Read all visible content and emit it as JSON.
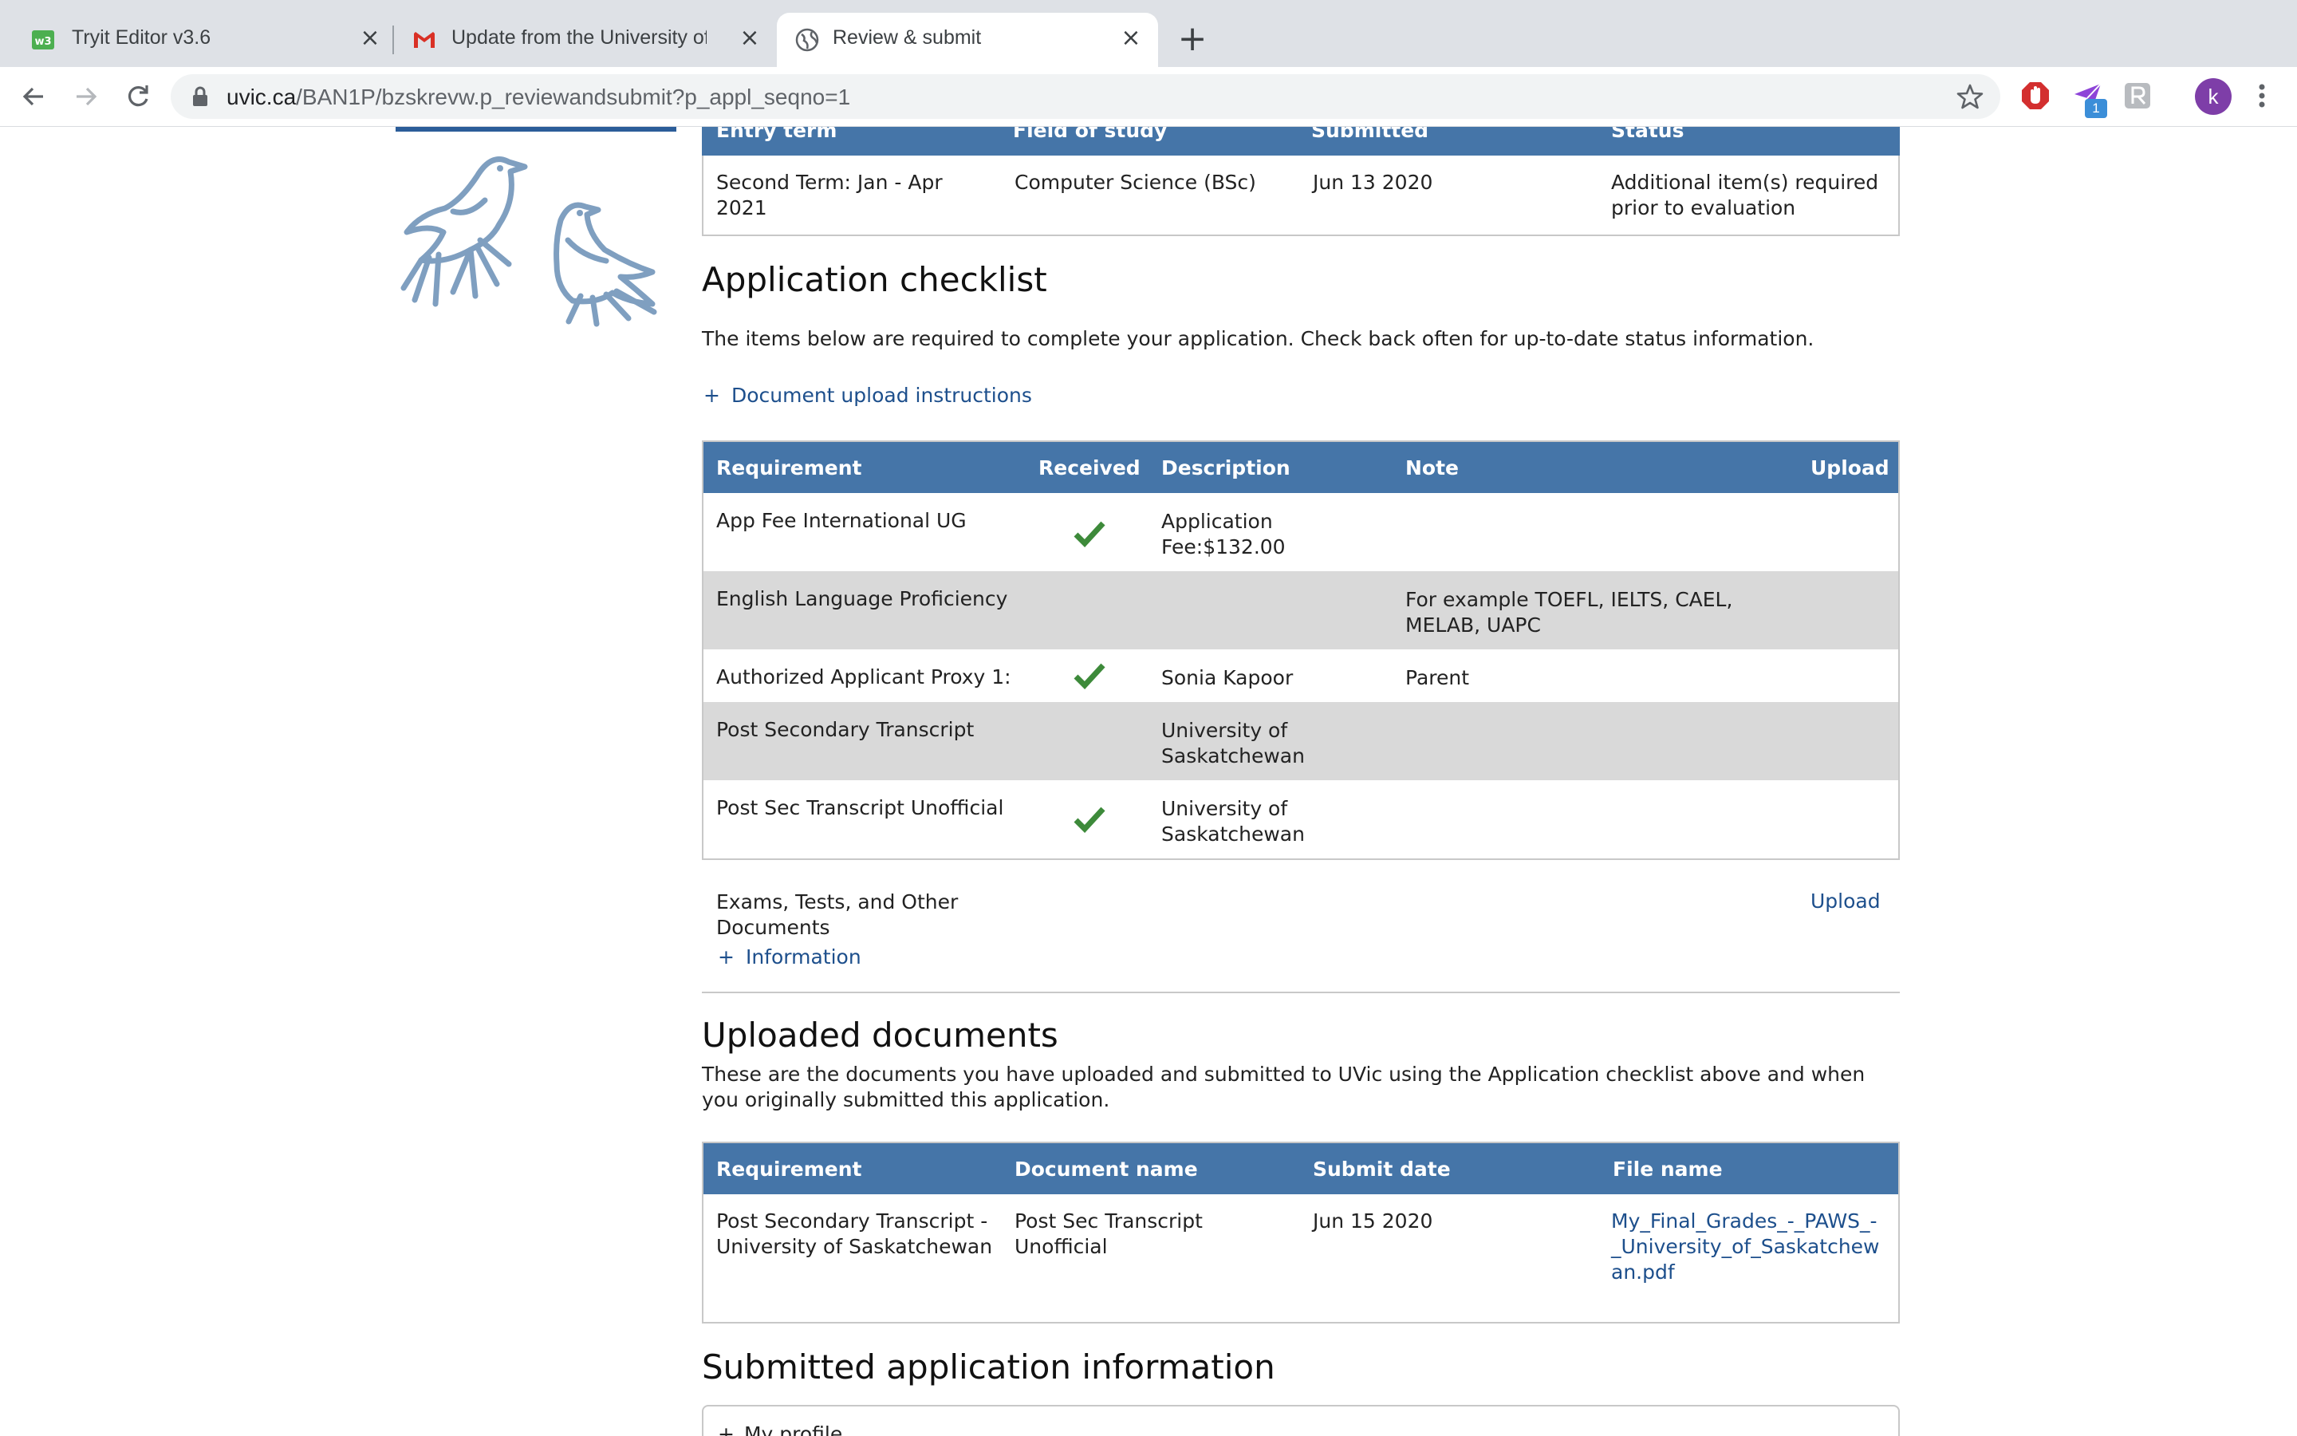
{
  "browser": {
    "tabs": [
      {
        "title": "Tryit Editor v3.6",
        "active": false
      },
      {
        "title": "Update from the University of V",
        "active": false
      },
      {
        "title": "Review & submit",
        "active": true
      }
    ],
    "new_tab_label": "+",
    "close_glyph": "×",
    "url_host": "uvic.ca",
    "url_path": "/BAN1P/bzskrevw.p_reviewandsubmit?p_appl_seqno=1",
    "ext_badge_count": "1",
    "profile_initial": "k"
  },
  "summary_table": {
    "headers": [
      "Entry term",
      "Field of study",
      "Submitted",
      "Status"
    ],
    "row": [
      "Second Term: Jan - Apr 2021",
      "Computer Science (BSc)",
      "Jun 13 2020",
      "Additional item(s) required prior to evaluation"
    ]
  },
  "checklist": {
    "title": "Application checklist",
    "intro": "The items below are required to complete your application. Check back often for up-to-date status information.",
    "upload_instructions_link": "Document upload instructions",
    "expand_glyph": "+",
    "headers": {
      "requirement": "Requirement",
      "received": "Received",
      "description": "Description",
      "note": "Note",
      "upload": "Upload"
    },
    "rows": [
      {
        "requirement": "App Fee International UG",
        "received": true,
        "description": "Application Fee:$132.00",
        "note": ""
      },
      {
        "requirement": "English Language Proficiency",
        "received": false,
        "description": "",
        "note": "For example TOEFL, IELTS, CAEL, MELAB, UAPC"
      },
      {
        "requirement": "Authorized Applicant Proxy 1:",
        "received": true,
        "description": "Sonia Kapoor",
        "note": "Parent"
      },
      {
        "requirement": "Post Secondary Transcript",
        "received": false,
        "description": "University of Saskatchewan",
        "note": ""
      },
      {
        "requirement": "Post Sec Transcript Unofficial",
        "received": true,
        "description": "University of Saskatchewan",
        "note": ""
      }
    ],
    "exams_label": "Exams, Tests, and Other Documents",
    "exams_upload_link": "Upload",
    "information_link": "Information"
  },
  "uploaded": {
    "title": "Uploaded documents",
    "intro": "These are the documents you have uploaded and submitted to UVic using the Application checklist above and when you originally submitted this application.",
    "headers": [
      "Requirement",
      "Document name",
      "Submit date",
      "File name"
    ],
    "rows": [
      {
        "requirement": "Post Secondary Transcript - University of Saskatchewan",
        "document_name": "Post Sec Transcript Unofficial",
        "submit_date": "Jun 15 2020",
        "file_name": "My_Final_Grades_-_PAWS_-_University_of_Saskatchewan.pdf"
      }
    ]
  },
  "submitted_info": {
    "title": "Submitted application information",
    "first_section": "My profile"
  },
  "colors": {
    "table_header": "#4575a8",
    "check": "#3d8a3a",
    "link": "#1d4f8c",
    "row_shaded": "#d9d9d9"
  }
}
